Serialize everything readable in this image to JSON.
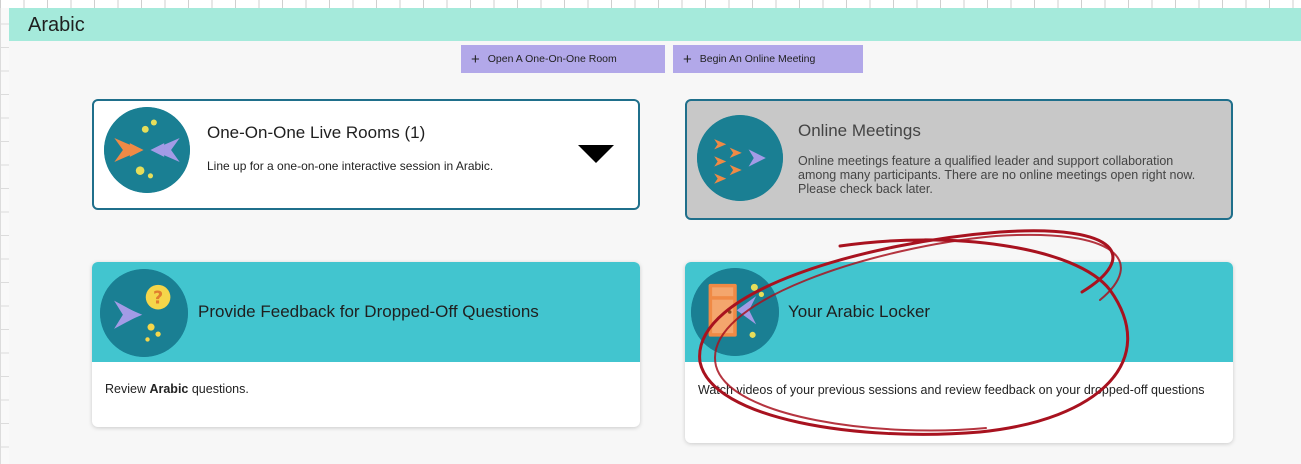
{
  "page_title": "Arabic",
  "actions": {
    "open_room": "Open A One-On-One Room",
    "begin_meeting": "Begin An Online Meeting"
  },
  "cards": {
    "one_on_one": {
      "title": "One-On-One Live Rooms (1)",
      "description": "Line up for a one-on-one interactive session in Arabic."
    },
    "online_meetings": {
      "title": "Online Meetings",
      "description": "Online meetings feature a qualified leader and support collaboration among many participants. There are no online meetings open right now. Please check back later."
    },
    "feedback": {
      "title": "Provide Feedback for Dropped-Off Questions",
      "body_prefix": "Review ",
      "body_bold": "Arabic",
      "body_suffix": " questions."
    },
    "locker": {
      "title": "Your Arabic Locker",
      "body": "Watch videos of your previous sessions and review feedback on your dropped-off questions"
    }
  },
  "colors": {
    "title_bar": "#a5eadb",
    "action_buttons": "#b2a8e9",
    "card_header": "#42c5cf",
    "card_border": "#1f6f8b",
    "annotation_circle": "#a8121f"
  },
  "icons": {
    "one_on_one": "two-fish-icon",
    "online_meetings": "fish-school-icon",
    "feedback": "fish-question-icon",
    "locker": "locker-fish-icon",
    "toggle": "caret-down-icon"
  }
}
